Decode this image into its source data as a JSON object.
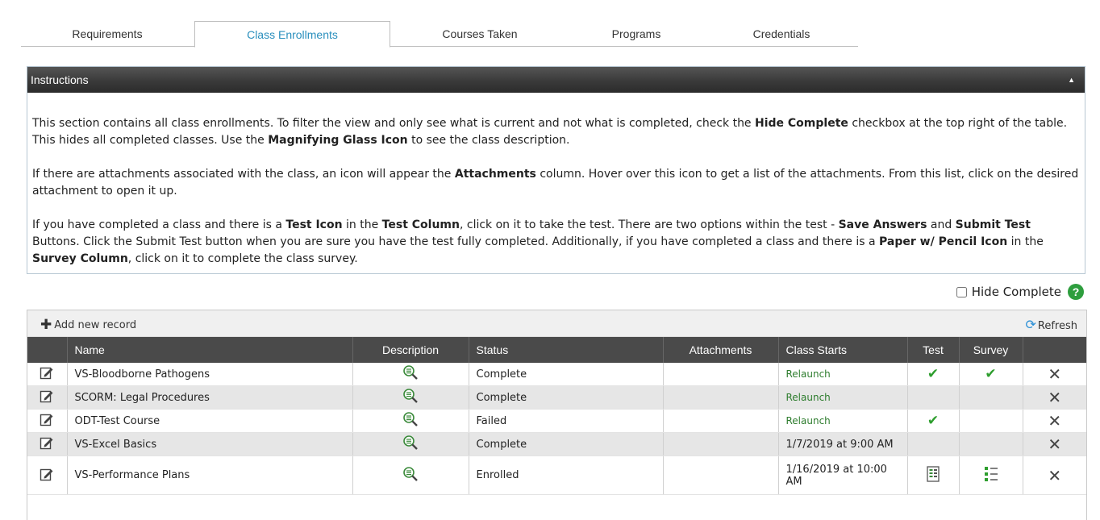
{
  "tabs": [
    "Requirements",
    "Class Enrollments",
    "Courses Taken",
    "Programs",
    "Credentials"
  ],
  "active_tab": "Class Enrollments",
  "instructions": {
    "title": "Instructions",
    "p1": {
      "a": "This section contains all class enrollments.  To filter the view and only see what is current and not what is completed, check the ",
      "b1": "Hide Complete",
      "c": " checkbox at the top right of the table.  This hides all completed classes.  Use the ",
      "b2": "Magnifying Glass Icon",
      "d": " to see the class description."
    },
    "p2": {
      "a": "If there are attachments associated with the class, an icon will appear the ",
      "b1": "Attachments",
      "c": " column.  Hover over this icon to get a list of the attachments.  From this list, click on the desired attachment to open it up."
    },
    "p3": {
      "a": "If you have completed a class and there is a ",
      "b1": "Test Icon",
      "c": " in the ",
      "b2": "Test Column",
      "d": ", click on it to take the test.  There are two options within the test - ",
      "b3": "Save Answers",
      "e": " and ",
      "b4": "Submit Test",
      "f": " Buttons.  Click the Submit Test button when you are sure you have the test fully completed.  Additionally, if you have completed a class and there is a ",
      "b5": "Paper w/ Pencil Icon",
      "g": " in the ",
      "b6": "Survey Column",
      "h": ", click on it to complete the class survey."
    }
  },
  "hide_complete_label": "Hide Complete",
  "help_icon_glyph": "?",
  "toolbar": {
    "add_label": "Add new record",
    "refresh_label": "Refresh"
  },
  "columns": [
    "",
    "Name",
    "Description",
    "Status",
    "Attachments",
    "Class Starts",
    "Test",
    "Survey",
    ""
  ],
  "rows": [
    {
      "name": "VS-Bloodborne Pathogens",
      "status": "Complete",
      "class_starts": "Relaunch",
      "starts_is_link": true,
      "test": "check",
      "survey": "check"
    },
    {
      "name": "SCORM: Legal Procedures",
      "status": "Complete",
      "class_starts": "Relaunch",
      "starts_is_link": true,
      "test": "",
      "survey": ""
    },
    {
      "name": "ODT-Test Course",
      "status": "Failed",
      "class_starts": "Relaunch",
      "starts_is_link": true,
      "test": "check",
      "survey": ""
    },
    {
      "name": "VS-Excel Basics",
      "status": "Complete",
      "class_starts": "1/7/2019 at 9:00 AM",
      "starts_is_link": false,
      "test": "",
      "survey": ""
    },
    {
      "name": "VS-Performance Plans",
      "status": "Enrolled",
      "class_starts": "1/16/2019 at 10:00 AM",
      "starts_is_link": false,
      "test": "test-icon",
      "survey": "survey-icon"
    }
  ],
  "colors": {
    "accent": "#2a8fbd",
    "check": "#2e9e2e",
    "header_bg": "#4a4a4a",
    "relaunch": "#2e7d2e"
  }
}
